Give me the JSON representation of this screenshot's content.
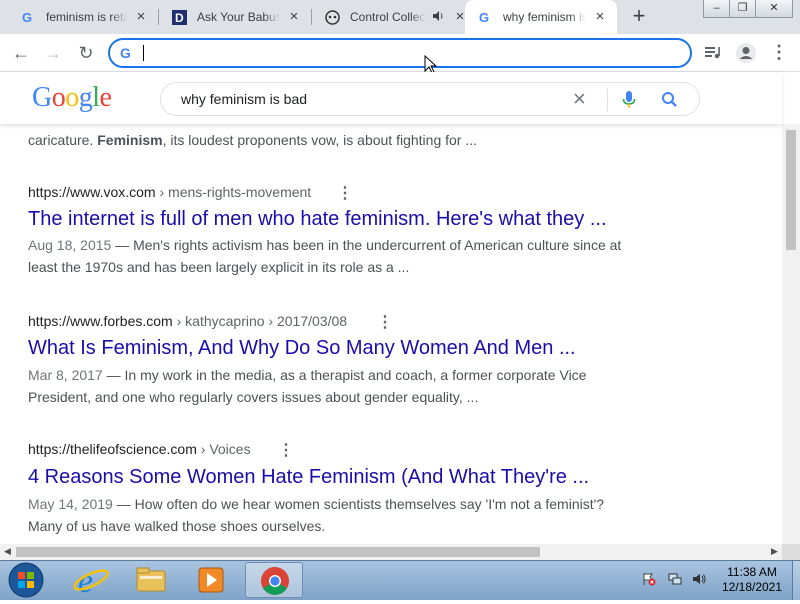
{
  "tabs": [
    {
      "title": "feminism is retarded",
      "favicon": "google-g-icon",
      "close": "×"
    },
    {
      "title": "Ask Your Babushka",
      "favicon": "d-logo-icon",
      "close": "×"
    },
    {
      "title": "Control Collection",
      "favicon": "mask-icon",
      "audio": "speaker-icon",
      "close": "×"
    },
    {
      "title": "why feminism is bad",
      "favicon": "google-g-icon",
      "close": "×"
    }
  ],
  "new_tab": "+",
  "window_controls": {
    "minimize": "–",
    "maximize": "❐",
    "close": "✕"
  },
  "toolbar": {
    "back": "←",
    "forward": "→",
    "reload": "↻",
    "omnibox_value": "",
    "omnibox_icon": "G"
  },
  "google": {
    "logo": [
      "G",
      "o",
      "o",
      "g",
      "l",
      "e"
    ],
    "query": "why feminism is bad",
    "clear": "×"
  },
  "results": {
    "partial_snippet_prefix": "caricature. ",
    "partial_snippet_bold": "Feminism",
    "partial_snippet_rest": ", its loudest proponents vow, is about fighting for ...",
    "items": [
      {
        "domain": "https://www.vox.com",
        "path": " › mens-rights-movement",
        "title": "The internet is full of men who hate feminism. Here's what they ...",
        "date": "Aug 18, 2015",
        "snippet_line1": " — Men's rights activism has been in the undercurrent of American culture since at",
        "snippet_line2": "least the 1970s and has been largely explicit in its role as a ..."
      },
      {
        "domain": "https://www.forbes.com",
        "path": " › kathycaprino › 2017/03/08",
        "title": "What Is Feminism, And Why Do So Many Women And Men ...",
        "date": "Mar 8, 2017",
        "snippet_line1": " — In my work in the media, as a therapist and coach, a former corporate Vice",
        "snippet_line2": "President, and one who regularly covers issues about gender equality, ..."
      },
      {
        "domain": "https://thelifeofscience.com",
        "path": " › Voices",
        "title": "4 Reasons Some Women Hate Feminism (And What They're ...",
        "date": "May 14, 2019",
        "snippet_line1": " — How often do we hear women scientists themselves say 'I'm not a feminist'?",
        "snippet_line2": "Many of us have walked those shoes ourselves."
      }
    ]
  },
  "kebab": "⋮",
  "taskbar": {
    "items": [
      "start-orb-icon",
      "internet-explorer-icon",
      "file-explorer-icon",
      "media-player-icon",
      "chrome-icon"
    ],
    "time": "11:38 AM",
    "date": "12/18/2021"
  },
  "colors": {
    "link": "#1a0dab",
    "accent": "#1a73e8",
    "logo_blue": "#4285f4",
    "logo_red": "#ea4335",
    "logo_yellow": "#fbbc05",
    "logo_green": "#34a853"
  }
}
